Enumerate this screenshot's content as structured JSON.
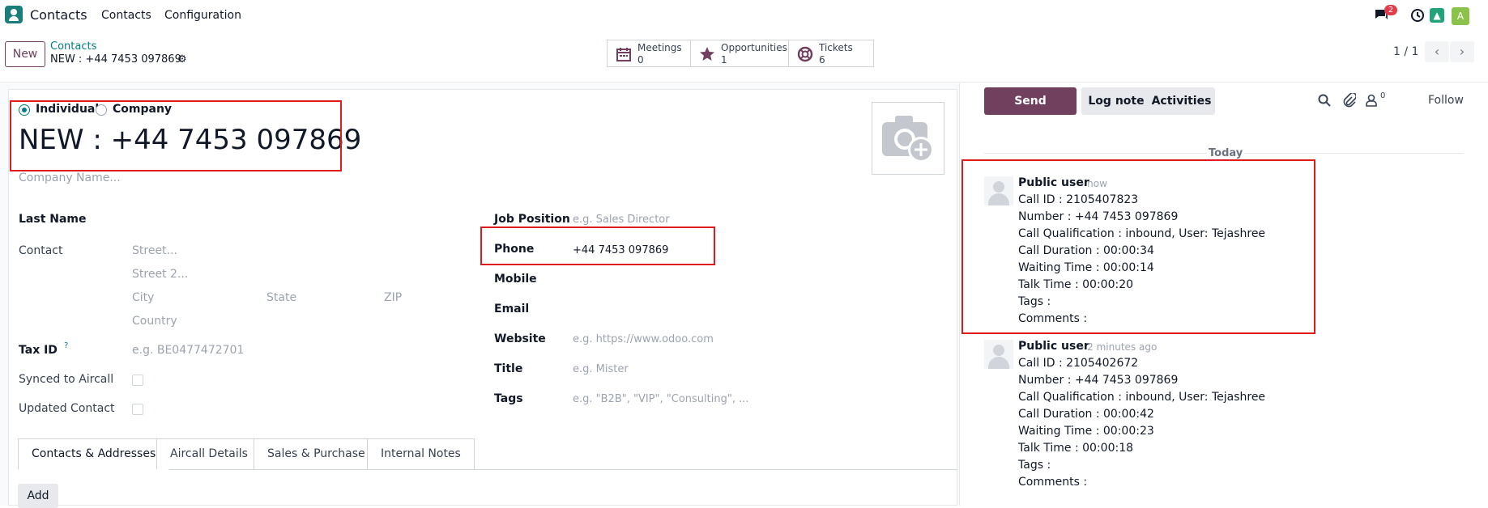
{
  "nav": {
    "app_name": "Contacts",
    "menu": [
      "Contacts",
      "Configuration"
    ],
    "message_count": "2",
    "avatar_letter": "A"
  },
  "control": {
    "new_label": "New",
    "breadcrumb_parent": "Contacts",
    "breadcrumb_current": "NEW : +44 7453 097869",
    "smart_buttons": [
      {
        "label": "Meetings",
        "value": "0",
        "icon": "calendar-icon"
      },
      {
        "label": "Opportunities",
        "value": "1",
        "icon": "star-icon"
      },
      {
        "label": "Tickets",
        "value": "6",
        "icon": "lifebuoy-icon"
      }
    ],
    "pager": "1 / 1"
  },
  "form": {
    "type_individual": "Individual",
    "type_company": "Company",
    "name": "NEW : +44 7453 097869",
    "company_placeholder": "Company Name...",
    "last_name_label": "Last Name",
    "contact_label": "Contact",
    "street_ph": "Street...",
    "street2_ph": "Street 2...",
    "city_ph": "City",
    "state_ph": "State",
    "zip_ph": "ZIP",
    "country_ph": "Country",
    "taxid_label": "Tax ID",
    "taxid_help": "?",
    "taxid_ph": "e.g. BE0477472701",
    "synced_label": "Synced to Aircall",
    "updated_label": "Updated Contact",
    "job_label": "Job Position",
    "job_ph": "e.g. Sales Director",
    "phone_label": "Phone",
    "phone_value": "+44 7453 097869",
    "mobile_label": "Mobile",
    "email_label": "Email",
    "website_label": "Website",
    "website_ph": "e.g. https://www.odoo.com",
    "title_label": "Title",
    "title_ph": "e.g. Mister",
    "tags_label": "Tags",
    "tags_ph": "e.g. \"B2B\", \"VIP\", \"Consulting\", ...",
    "tabs": [
      "Contacts & Addresses",
      "Aircall Details",
      "Sales & Purchase",
      "Internal Notes"
    ],
    "add_label": "Add"
  },
  "chatter": {
    "send_message": "Send message",
    "log_note": "Log note",
    "activities": "Activities",
    "follower_count": "0",
    "follow": "Follow",
    "today": "Today",
    "messages": [
      {
        "author": "Public user",
        "when": "- now",
        "lines": [
          "Call ID : 2105407823",
          "Number : +44 7453 097869",
          "Call Qualification : inbound, User: Tejashree",
          "Call Duration : 00:00:34",
          "Waiting Time : 00:00:14",
          "Talk Time : 00:00:20",
          "Tags :",
          "Comments :"
        ]
      },
      {
        "author": "Public user",
        "when": "- 2 minutes ago",
        "lines": [
          "Call ID : 2105402672",
          "Number : +44 7453 097869",
          "Call Qualification : inbound, User: Tejashree",
          "Call Duration : 00:00:42",
          "Waiting Time : 00:00:23",
          "Talk Time : 00:00:18",
          "Tags :",
          "Comments :"
        ]
      }
    ]
  },
  "colors": {
    "primary": "#71405e",
    "link": "#017e84",
    "highlight": "#e01b1b"
  }
}
